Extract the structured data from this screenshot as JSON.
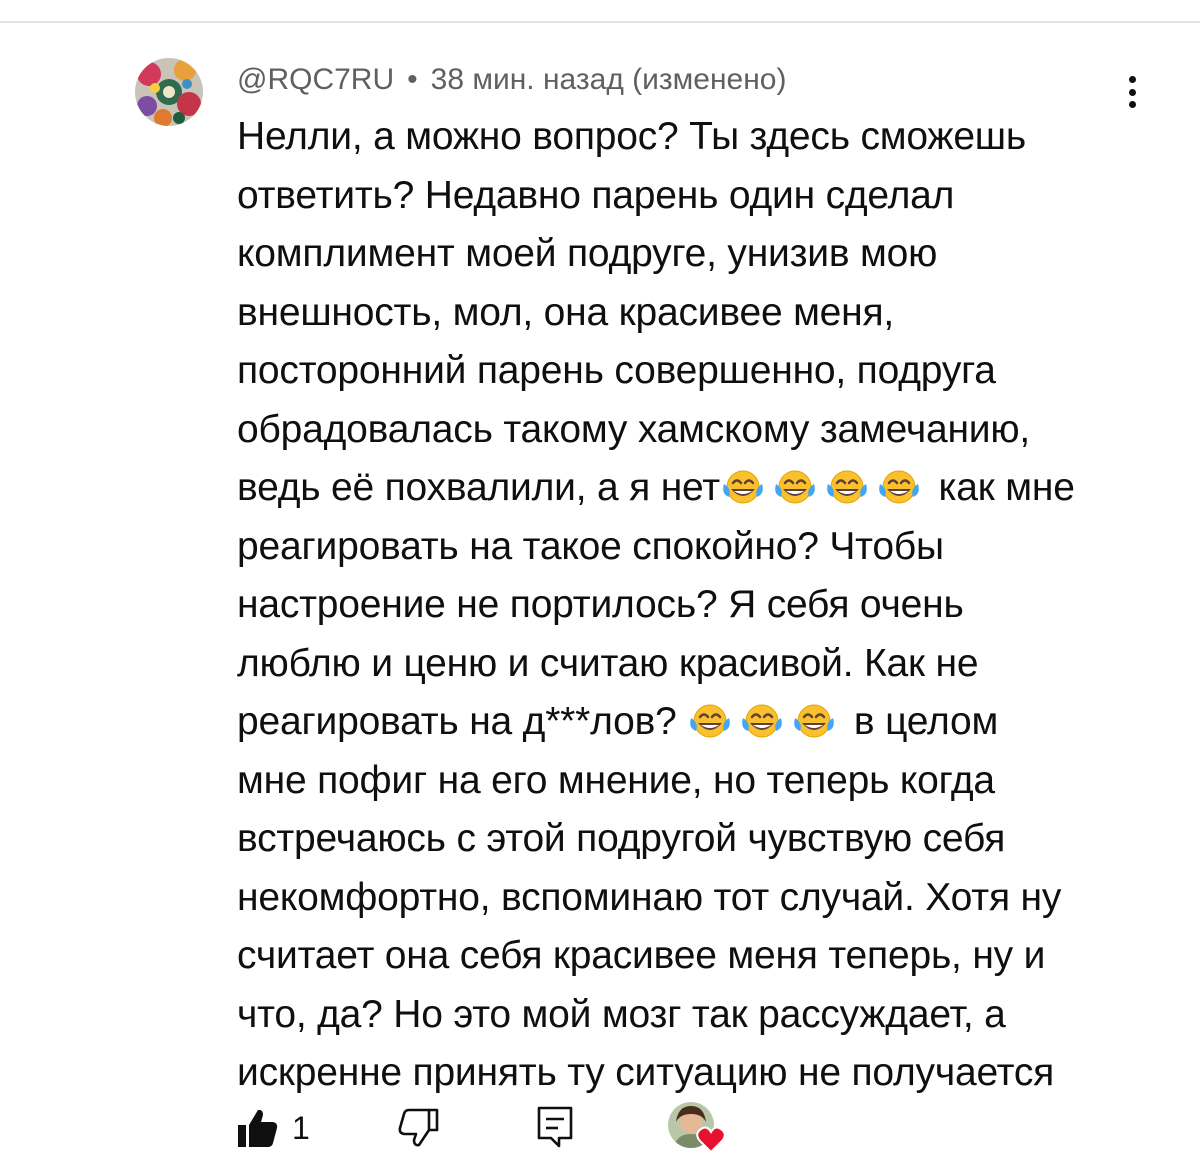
{
  "comment": {
    "author": "@RQC7RU",
    "separator": "•",
    "timestamp": "38 мин. назад (изменено)",
    "lines": [
      "Нелли, а можно вопрос? Ты здесь сможешь",
      "ответить? Недавно парень один сделал",
      "комплимент моей подруге, унизив мою",
      "внешность, мол, она красивее меня,",
      "посторонний парень совершенно, подруга",
      "обрадовалась такому хамскому замечанию,",
      "ведь её похвалили, а я нет",
      " как мне",
      "реагировать на такое спокойно? Чтобы",
      "настроение не портилось? Я себя очень",
      "люблю и ценю и считаю красивой. Как не",
      "реагировать на д***лов? ",
      " в целом",
      "мне пофиг на его мнение, но теперь когда",
      "встречаюсь с этой подругой чувствую себя",
      "некомфортно, вспоминаю тот случай. Хотя ну",
      "считает она себя красивее меня теперь, ну и",
      "что, да? Но это мой мозг так рассуждает, а",
      "искренне принять ту ситуацию не получается"
    ],
    "emoji_name": "face-with-tears-of-joy-icon"
  },
  "actions": {
    "like_count": "1",
    "icons": [
      "thumbs-up-icon",
      "thumbs-down-icon",
      "reply-icon",
      "creator-heart-icon"
    ]
  },
  "colors": {
    "text": "#0f0f0f",
    "meta": "#606060",
    "heart": "#e8112d",
    "emoji_face": "#fbc02d"
  }
}
